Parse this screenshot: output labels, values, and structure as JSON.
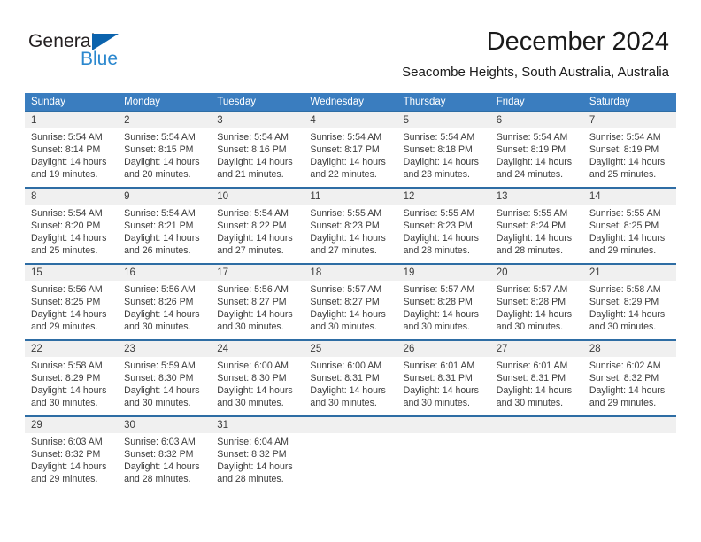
{
  "brand": {
    "name_part1": "General",
    "name_part2": "Blue"
  },
  "header": {
    "title": "December 2024",
    "location": "Seacombe Heights, South Australia, Australia"
  },
  "weekdays": [
    "Sunday",
    "Monday",
    "Tuesday",
    "Wednesday",
    "Thursday",
    "Friday",
    "Saturday"
  ],
  "colors": {
    "header_band": "#3a7dbf",
    "rule": "#2e6da4",
    "daynum_band": "#f0f0f0",
    "brand_blue": "#2a87ce",
    "brand_flag": "#0b63ad",
    "text": "#3c3c3c"
  },
  "weeks": [
    {
      "days": [
        {
          "num": "1",
          "l1": "Sunrise: 5:54 AM",
          "l2": "Sunset: 8:14 PM",
          "l3": "Daylight: 14 hours",
          "l4": "and 19 minutes."
        },
        {
          "num": "2",
          "l1": "Sunrise: 5:54 AM",
          "l2": "Sunset: 8:15 PM",
          "l3": "Daylight: 14 hours",
          "l4": "and 20 minutes."
        },
        {
          "num": "3",
          "l1": "Sunrise: 5:54 AM",
          "l2": "Sunset: 8:16 PM",
          "l3": "Daylight: 14 hours",
          "l4": "and 21 minutes."
        },
        {
          "num": "4",
          "l1": "Sunrise: 5:54 AM",
          "l2": "Sunset: 8:17 PM",
          "l3": "Daylight: 14 hours",
          "l4": "and 22 minutes."
        },
        {
          "num": "5",
          "l1": "Sunrise: 5:54 AM",
          "l2": "Sunset: 8:18 PM",
          "l3": "Daylight: 14 hours",
          "l4": "and 23 minutes."
        },
        {
          "num": "6",
          "l1": "Sunrise: 5:54 AM",
          "l2": "Sunset: 8:19 PM",
          "l3": "Daylight: 14 hours",
          "l4": "and 24 minutes."
        },
        {
          "num": "7",
          "l1": "Sunrise: 5:54 AM",
          "l2": "Sunset: 8:19 PM",
          "l3": "Daylight: 14 hours",
          "l4": "and 25 minutes."
        }
      ]
    },
    {
      "days": [
        {
          "num": "8",
          "l1": "Sunrise: 5:54 AM",
          "l2": "Sunset: 8:20 PM",
          "l3": "Daylight: 14 hours",
          "l4": "and 25 minutes."
        },
        {
          "num": "9",
          "l1": "Sunrise: 5:54 AM",
          "l2": "Sunset: 8:21 PM",
          "l3": "Daylight: 14 hours",
          "l4": "and 26 minutes."
        },
        {
          "num": "10",
          "l1": "Sunrise: 5:54 AM",
          "l2": "Sunset: 8:22 PM",
          "l3": "Daylight: 14 hours",
          "l4": "and 27 minutes."
        },
        {
          "num": "11",
          "l1": "Sunrise: 5:55 AM",
          "l2": "Sunset: 8:23 PM",
          "l3": "Daylight: 14 hours",
          "l4": "and 27 minutes."
        },
        {
          "num": "12",
          "l1": "Sunrise: 5:55 AM",
          "l2": "Sunset: 8:23 PM",
          "l3": "Daylight: 14 hours",
          "l4": "and 28 minutes."
        },
        {
          "num": "13",
          "l1": "Sunrise: 5:55 AM",
          "l2": "Sunset: 8:24 PM",
          "l3": "Daylight: 14 hours",
          "l4": "and 28 minutes."
        },
        {
          "num": "14",
          "l1": "Sunrise: 5:55 AM",
          "l2": "Sunset: 8:25 PM",
          "l3": "Daylight: 14 hours",
          "l4": "and 29 minutes."
        }
      ]
    },
    {
      "days": [
        {
          "num": "15",
          "l1": "Sunrise: 5:56 AM",
          "l2": "Sunset: 8:25 PM",
          "l3": "Daylight: 14 hours",
          "l4": "and 29 minutes."
        },
        {
          "num": "16",
          "l1": "Sunrise: 5:56 AM",
          "l2": "Sunset: 8:26 PM",
          "l3": "Daylight: 14 hours",
          "l4": "and 30 minutes."
        },
        {
          "num": "17",
          "l1": "Sunrise: 5:56 AM",
          "l2": "Sunset: 8:27 PM",
          "l3": "Daylight: 14 hours",
          "l4": "and 30 minutes."
        },
        {
          "num": "18",
          "l1": "Sunrise: 5:57 AM",
          "l2": "Sunset: 8:27 PM",
          "l3": "Daylight: 14 hours",
          "l4": "and 30 minutes."
        },
        {
          "num": "19",
          "l1": "Sunrise: 5:57 AM",
          "l2": "Sunset: 8:28 PM",
          "l3": "Daylight: 14 hours",
          "l4": "and 30 minutes."
        },
        {
          "num": "20",
          "l1": "Sunrise: 5:57 AM",
          "l2": "Sunset: 8:28 PM",
          "l3": "Daylight: 14 hours",
          "l4": "and 30 minutes."
        },
        {
          "num": "21",
          "l1": "Sunrise: 5:58 AM",
          "l2": "Sunset: 8:29 PM",
          "l3": "Daylight: 14 hours",
          "l4": "and 30 minutes."
        }
      ]
    },
    {
      "days": [
        {
          "num": "22",
          "l1": "Sunrise: 5:58 AM",
          "l2": "Sunset: 8:29 PM",
          "l3": "Daylight: 14 hours",
          "l4": "and 30 minutes."
        },
        {
          "num": "23",
          "l1": "Sunrise: 5:59 AM",
          "l2": "Sunset: 8:30 PM",
          "l3": "Daylight: 14 hours",
          "l4": "and 30 minutes."
        },
        {
          "num": "24",
          "l1": "Sunrise: 6:00 AM",
          "l2": "Sunset: 8:30 PM",
          "l3": "Daylight: 14 hours",
          "l4": "and 30 minutes."
        },
        {
          "num": "25",
          "l1": "Sunrise: 6:00 AM",
          "l2": "Sunset: 8:31 PM",
          "l3": "Daylight: 14 hours",
          "l4": "and 30 minutes."
        },
        {
          "num": "26",
          "l1": "Sunrise: 6:01 AM",
          "l2": "Sunset: 8:31 PM",
          "l3": "Daylight: 14 hours",
          "l4": "and 30 minutes."
        },
        {
          "num": "27",
          "l1": "Sunrise: 6:01 AM",
          "l2": "Sunset: 8:31 PM",
          "l3": "Daylight: 14 hours",
          "l4": "and 30 minutes."
        },
        {
          "num": "28",
          "l1": "Sunrise: 6:02 AM",
          "l2": "Sunset: 8:32 PM",
          "l3": "Daylight: 14 hours",
          "l4": "and 29 minutes."
        }
      ]
    },
    {
      "days": [
        {
          "num": "29",
          "l1": "Sunrise: 6:03 AM",
          "l2": "Sunset: 8:32 PM",
          "l3": "Daylight: 14 hours",
          "l4": "and 29 minutes."
        },
        {
          "num": "30",
          "l1": "Sunrise: 6:03 AM",
          "l2": "Sunset: 8:32 PM",
          "l3": "Daylight: 14 hours",
          "l4": "and 28 minutes."
        },
        {
          "num": "31",
          "l1": "Sunrise: 6:04 AM",
          "l2": "Sunset: 8:32 PM",
          "l3": "Daylight: 14 hours",
          "l4": "and 28 minutes."
        },
        {
          "num": "",
          "l1": "",
          "l2": "",
          "l3": "",
          "l4": ""
        },
        {
          "num": "",
          "l1": "",
          "l2": "",
          "l3": "",
          "l4": ""
        },
        {
          "num": "",
          "l1": "",
          "l2": "",
          "l3": "",
          "l4": ""
        },
        {
          "num": "",
          "l1": "",
          "l2": "",
          "l3": "",
          "l4": ""
        }
      ]
    }
  ]
}
